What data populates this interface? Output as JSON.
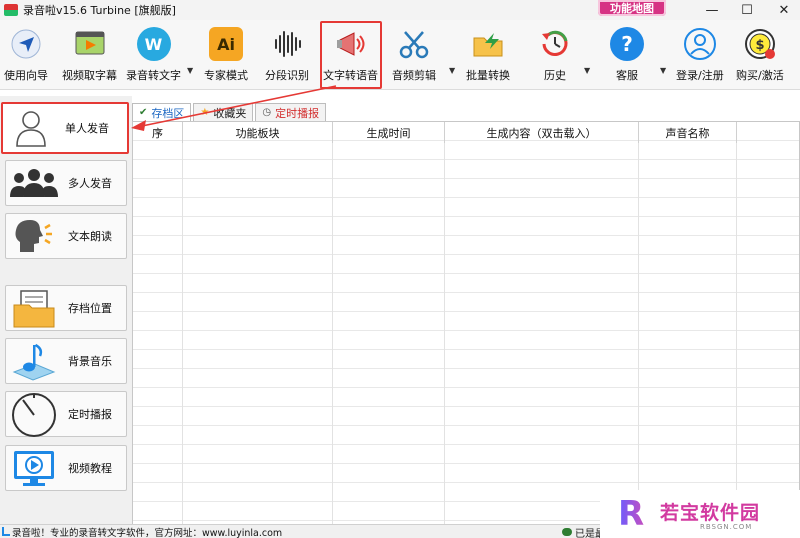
{
  "window": {
    "title": "录音啦v15.6 Turbine [旗舰版]",
    "func_map_label": "功能地图",
    "min": "—",
    "max": "☐",
    "close": "✕"
  },
  "toolbar": {
    "items": [
      {
        "label": "使用向导",
        "icon": "navigation-arrow-icon"
      },
      {
        "label": "视频取字幕",
        "icon": "video-subtitle-icon"
      },
      {
        "label": "录音转文字",
        "icon": "w-letter-icon"
      },
      {
        "label": "专家模式",
        "icon": "ai-icon"
      },
      {
        "label": "分段识别",
        "icon": "waveform-icon"
      },
      {
        "label": "文字转语音",
        "icon": "megaphone-icon"
      },
      {
        "label": "音频剪辑",
        "icon": "scissors-icon"
      },
      {
        "label": "批量转换",
        "icon": "folder-arrow-icon"
      },
      {
        "label": "历史",
        "icon": "history-clock-icon"
      },
      {
        "label": "客服",
        "icon": "question-icon"
      },
      {
        "label": "登录/注册",
        "icon": "user-icon"
      },
      {
        "label": "购买/激活",
        "icon": "dollar-icon"
      }
    ],
    "icon_glyphs": {
      "ai": "Ai",
      "w": "W",
      "question": "?",
      "dollar": "$"
    }
  },
  "sidebar": {
    "items": [
      {
        "label": "单人发音",
        "icon": "single-person-icon"
      },
      {
        "label": "多人发音",
        "icon": "multi-person-icon"
      },
      {
        "label": "文本朗读",
        "icon": "speaking-head-icon"
      },
      {
        "label": "存档位置",
        "icon": "archive-folder-icon"
      },
      {
        "label": "背景音乐",
        "icon": "music-note-icon"
      },
      {
        "label": "定时播报",
        "icon": "timer-icon"
      },
      {
        "label": "视频教程",
        "icon": "video-tutorial-icon"
      }
    ]
  },
  "tabs": [
    {
      "label": "存档区",
      "icon": "check-icon"
    },
    {
      "label": "收藏夹",
      "icon": "star-icon"
    },
    {
      "label": "定时播报",
      "icon": "clock-icon"
    }
  ],
  "table": {
    "columns": [
      "序",
      "功能板块",
      "生成时间",
      "生成内容（双击载入）",
      "声音名称"
    ]
  },
  "status": {
    "left": "录音啦！专业的录音转文字软件，官方网址：www.luyinla.com",
    "right": "已是最"
  },
  "watermark": {
    "logo_letter": "R",
    "name": "若宝软件园",
    "site": "RBSGN.COM"
  },
  "colors": {
    "highlight": "#e53935",
    "tab_active": "#1a66c2",
    "tab_red": "#d32f2f",
    "func_map": "#d63384"
  }
}
